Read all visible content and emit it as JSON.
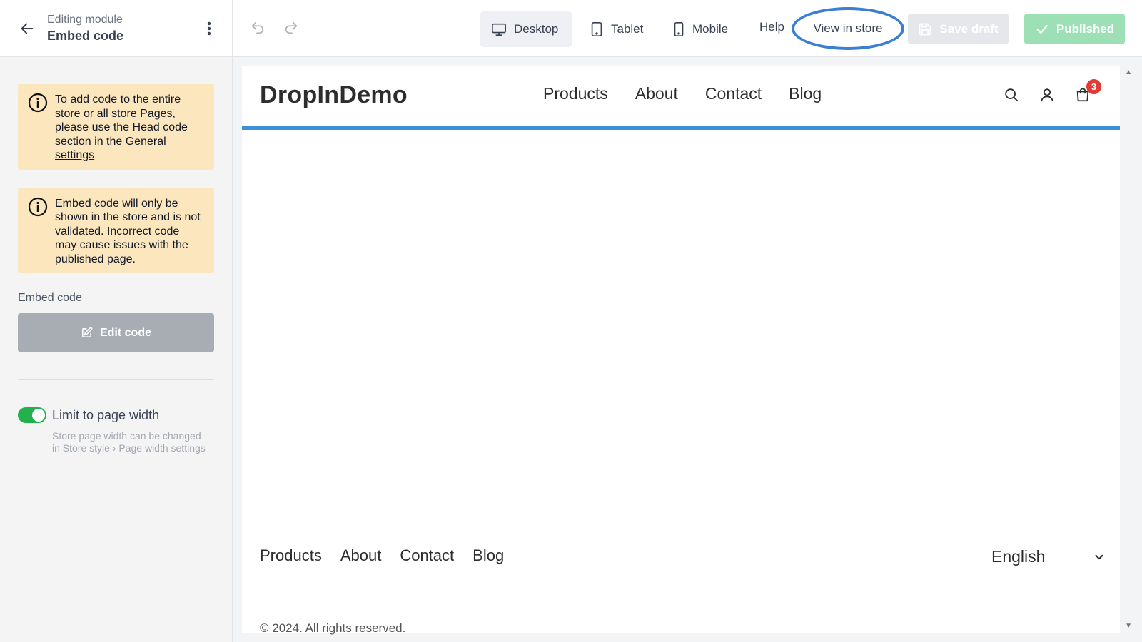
{
  "sidebar": {
    "editing_label": "Editing module",
    "module_name": "Embed code",
    "notice1": {
      "text_before": "To add code to the entire store or all store Pages, please use the Head code section in the ",
      "link_text": "General settings"
    },
    "notice2": {
      "text": "Embed code will only be shown in the store and is not validated. Incorrect code may cause issues with the published page."
    },
    "embed_label": "Embed code",
    "edit_code_label": "Edit code",
    "toggle": {
      "label": "Limit to page width",
      "checked": true,
      "hint": "Store page width can be changed in Store style › Page width settings"
    }
  },
  "toolbar": {
    "devices": [
      {
        "label": "Desktop",
        "icon": "desktop-icon",
        "active": true
      },
      {
        "label": "Tablet",
        "icon": "tablet-icon",
        "active": false
      },
      {
        "label": "Mobile",
        "icon": "mobile-icon",
        "active": false
      }
    ],
    "help_label": "Help",
    "view_store_label": "View in store",
    "save_draft_label": "Save draft",
    "published_label": "Published"
  },
  "preview": {
    "store_name": "DropInDemo",
    "nav": [
      "Products",
      "About",
      "Contact",
      "Blog"
    ],
    "cart_count": "3",
    "footer_nav": [
      "Products",
      "About",
      "Contact",
      "Blog"
    ],
    "language": "English",
    "copyright": "© 2024. All rights reserved."
  },
  "colors": {
    "highlight_ring": "#3b7fd4",
    "notice_bg": "#fbe6be",
    "toggle_on": "#22b14c",
    "published_bg": "#9ee0b6",
    "accent_line": "#3b8ee0",
    "cart_badge": "#e53935"
  }
}
